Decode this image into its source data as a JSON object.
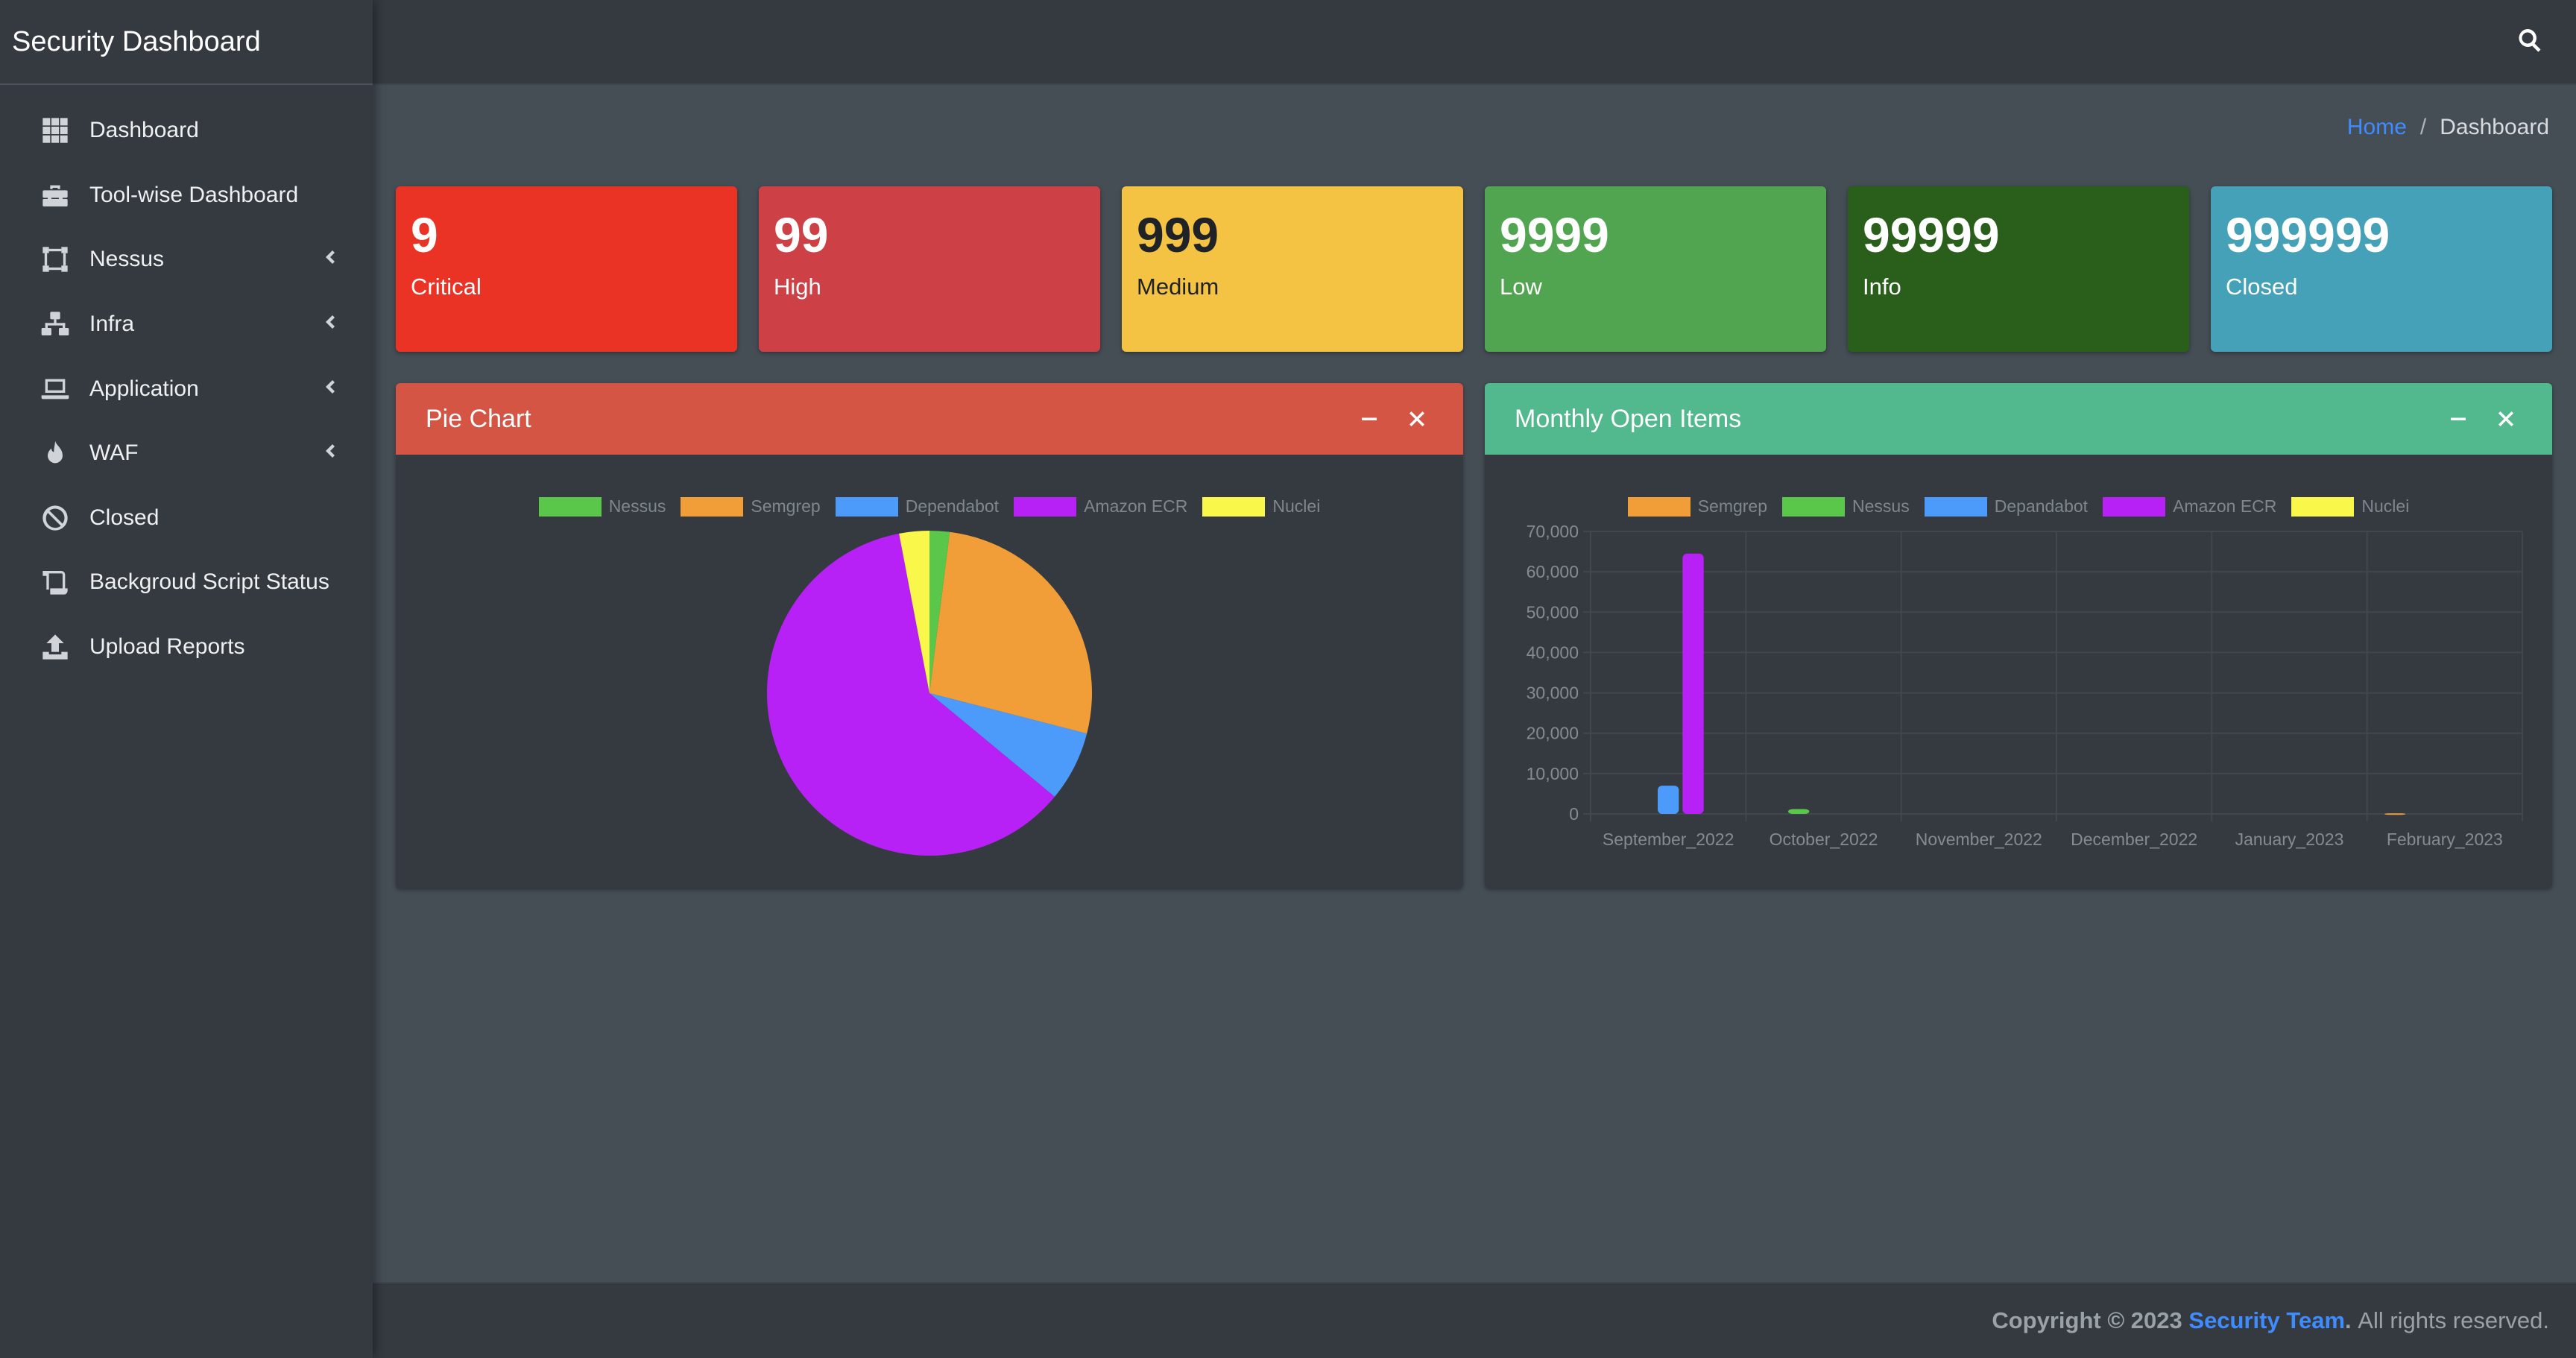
{
  "app": {
    "title": "Security Dashboard"
  },
  "sidebar": {
    "items": [
      {
        "label": "Dashboard",
        "icon": "grid-icon",
        "has_submenu": false
      },
      {
        "label": "Tool-wise Dashboard",
        "icon": "toolbox-icon",
        "has_submenu": false
      },
      {
        "label": "Nessus",
        "icon": "vector-square-icon",
        "has_submenu": true
      },
      {
        "label": "Infra",
        "icon": "network-icon",
        "has_submenu": true
      },
      {
        "label": "Application",
        "icon": "laptop-icon",
        "has_submenu": true
      },
      {
        "label": "WAF",
        "icon": "fire-icon",
        "has_submenu": true
      },
      {
        "label": "Closed",
        "icon": "ban-icon",
        "has_submenu": false
      },
      {
        "label": "Backgroud Script Status",
        "icon": "scroll-icon",
        "has_submenu": false
      },
      {
        "label": "Upload Reports",
        "icon": "upload-icon",
        "has_submenu": false
      }
    ]
  },
  "topbar": {
    "search_icon": "search-icon"
  },
  "breadcrumb": {
    "home": "Home",
    "separator": "/",
    "current": "Dashboard"
  },
  "stats": [
    {
      "value": "9",
      "label": "Critical",
      "color": "#ea3324",
      "text_color": "#ffffff"
    },
    {
      "value": "99",
      "label": "High",
      "color": "#cd4046",
      "text_color": "#ffffff"
    },
    {
      "value": "999",
      "label": "Medium",
      "color": "#f5c343",
      "text_color": "#1f2327"
    },
    {
      "value": "9999",
      "label": "Low",
      "color": "#52a550",
      "text_color": "#ffffff"
    },
    {
      "value": "99999",
      "label": "Info",
      "color": "#2a5f1b",
      "text_color": "#ffffff"
    },
    {
      "value": "999999",
      "label": "Closed",
      "color": "#44a1b7",
      "text_color": "#ffffff"
    }
  ],
  "pie_card": {
    "title": "Pie Chart",
    "header_color": "#d55545",
    "minimize_icon": "minus-icon",
    "close_icon": "close-icon"
  },
  "bar_card": {
    "title": "Monthly Open Items",
    "header_color": "#52b88d",
    "minimize_icon": "minus-icon",
    "close_icon": "close-icon"
  },
  "chart_data": [
    {
      "type": "pie",
      "categories": [
        "Nessus",
        "Semgrep",
        "Dependabot",
        "Amazon ECR",
        "Nuclei"
      ],
      "values": [
        2,
        27,
        7,
        61,
        3
      ],
      "colors": [
        "#5ac74b",
        "#f19e38",
        "#4c9bfa",
        "#b821f5",
        "#f9f74a"
      ],
      "legend": "top"
    },
    {
      "type": "bar",
      "categories": [
        "September_2022",
        "October_2022",
        "November_2022",
        "December_2022",
        "January_2023",
        "February_2023"
      ],
      "series": [
        {
          "name": "Semgrep",
          "color": "#f19e38",
          "values": [
            0,
            0,
            0,
            0,
            0,
            150
          ]
        },
        {
          "name": "Nessus",
          "color": "#5ac74b",
          "values": [
            0,
            1200,
            0,
            0,
            0,
            0
          ]
        },
        {
          "name": "Depandabot",
          "color": "#4c9bfa",
          "values": [
            7000,
            0,
            0,
            0,
            0,
            0
          ]
        },
        {
          "name": "Amazon ECR",
          "color": "#b821f5",
          "values": [
            64500,
            0,
            0,
            0,
            0,
            0
          ]
        },
        {
          "name": "Nuclei",
          "color": "#f9f74a",
          "values": [
            0,
            0,
            0,
            0,
            0,
            0
          ]
        }
      ],
      "yticks": [
        "70,000",
        "60,000",
        "50,000",
        "40,000",
        "30,000",
        "20,000",
        "10,000",
        "0"
      ],
      "ylim": [
        0,
        70000
      ],
      "grid": true,
      "legend": "top"
    }
  ],
  "footer": {
    "copyright": "Copyright © 2023",
    "team": "Security Team",
    "period": ".",
    "rights": "All rights reserved."
  }
}
